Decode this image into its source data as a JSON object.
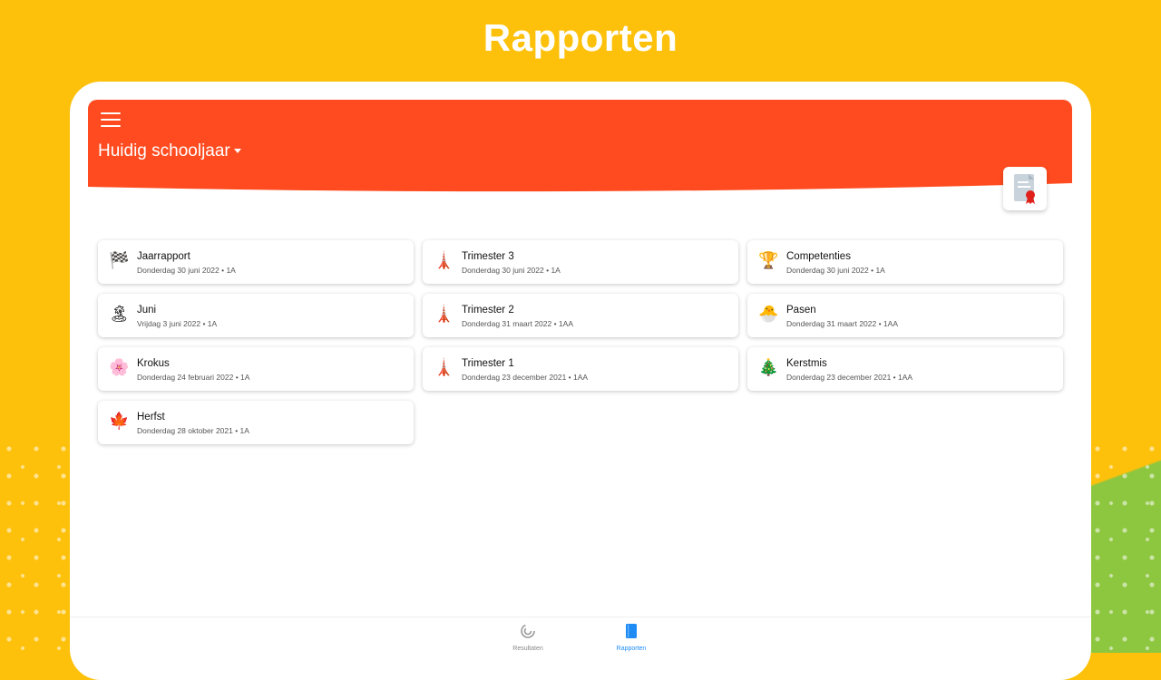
{
  "page": {
    "title": "Rapporten"
  },
  "header": {
    "school_year": "Huidig schooljaar"
  },
  "cards": [
    {
      "icon": "checkered-flag-icon",
      "glyph": "🏁",
      "title": "Jaarrapport",
      "subtitle": "Donderdag 30 juni 2022 • 1A"
    },
    {
      "icon": "lighthouse-icon",
      "glyph": "🗼",
      "title": "Trimester 3",
      "subtitle": "Donderdag 30 juni 2022 • 1A"
    },
    {
      "icon": "trophy-icon",
      "glyph": "🏆",
      "title": "Competenties",
      "subtitle": "Donderdag 30 juni 2022 • 1A"
    },
    {
      "icon": "island-icon",
      "glyph": "🏝",
      "title": "Juni",
      "subtitle": "Vrijdag 3 juni 2022 • 1A"
    },
    {
      "icon": "lighthouse-icon",
      "glyph": "🗼",
      "title": "Trimester 2",
      "subtitle": "Donderdag 31 maart 2022 • 1AA"
    },
    {
      "icon": "chick-icon",
      "glyph": "🐣",
      "title": "Pasen",
      "subtitle": "Donderdag 31 maart 2022 • 1AA"
    },
    {
      "icon": "cherry-blossom-icon",
      "glyph": "🌸",
      "title": "Krokus",
      "subtitle": "Donderdag 24 februari 2022 • 1A"
    },
    {
      "icon": "lighthouse-icon",
      "glyph": "🗼",
      "title": "Trimester 1",
      "subtitle": "Donderdag 23 december 2021 • 1AA"
    },
    {
      "icon": "christmas-tree-icon",
      "glyph": "🎄",
      "title": "Kerstmis",
      "subtitle": "Donderdag 23 december 2021 • 1AA"
    },
    {
      "icon": "maple-leaf-icon",
      "glyph": "🍁",
      "title": "Herfst",
      "subtitle": "Donderdag 28 oktober 2021 • 1A"
    }
  ],
  "bottom_nav": [
    {
      "label": "Resultaten",
      "icon": "results-icon"
    },
    {
      "label": "Rapporten",
      "icon": "book-icon"
    }
  ],
  "colors": {
    "background": "#FDC10B",
    "header": "#FF4B1F",
    "accent": "#1F8BF5",
    "green": "#8DC63F"
  }
}
